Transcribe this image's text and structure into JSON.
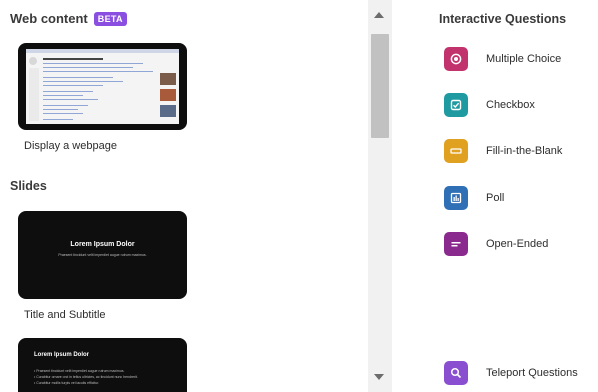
{
  "web_section": {
    "title": "Web content",
    "badge": "BETA",
    "item_caption": "Display a webpage"
  },
  "slides_section": {
    "title": "Slides",
    "title_subtitle": {
      "caption": "Title and Subtitle",
      "slide_title": "Lorem Ipsum Dolor",
      "slide_subtitle": "Praesent tincidunt velit imperdiet augue rutrum maximus."
    },
    "bullets_slide": {
      "slide_title": "Lorem Ipsum Dolor",
      "bullets": [
        "• Praesent tincidunt velit imperdiet augue rutrum maximus.",
        "• Curabitur ornare orci in tellus ultricies, ac tincidunt nunc hendrerit.",
        "• Curabitur mollis turpis vel iaculis efficitur."
      ]
    }
  },
  "interactive_questions": {
    "title": "Interactive Questions",
    "items": [
      {
        "label": "Multiple Choice",
        "icon": "radio-icon",
        "color": "#c2326d"
      },
      {
        "label": "Checkbox",
        "icon": "checkbox-icon",
        "color": "#1f9aa0"
      },
      {
        "label": "Fill-in-the-Blank",
        "icon": "blank-icon",
        "color": "#e0a020"
      },
      {
        "label": "Poll",
        "icon": "poll-icon",
        "color": "#2f6fb5"
      },
      {
        "label": "Open-Ended",
        "icon": "open-ended-icon",
        "color": "#8b2a8e"
      }
    ]
  },
  "teleport": {
    "label": "Teleport Questions",
    "icon": "search-icon",
    "color": "#8a4fd0"
  },
  "colors": {
    "beta_badge": "#8a4fe0",
    "scrollbar_thumb": "#c1c1c1"
  }
}
